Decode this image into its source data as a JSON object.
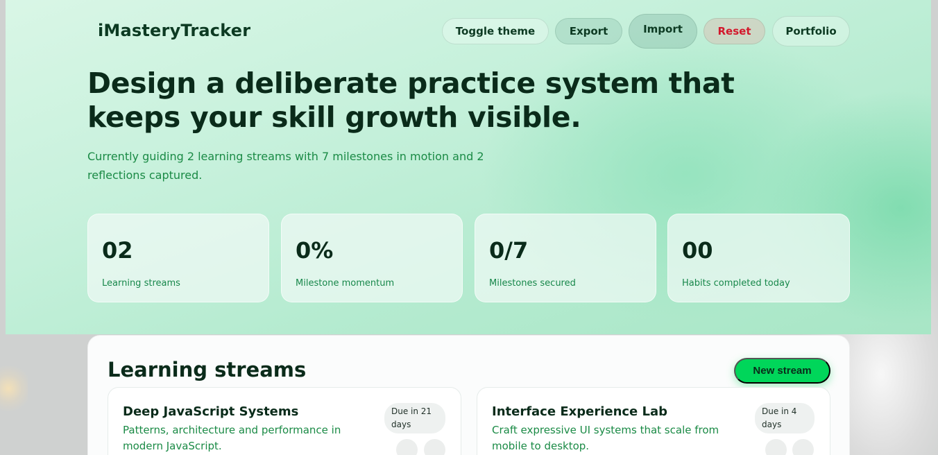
{
  "app": {
    "title": "iMasteryTracker"
  },
  "nav": {
    "toggle_theme": "Toggle theme",
    "export": "Export",
    "import": "Import",
    "reset": "Reset",
    "portfolio": "Portfolio"
  },
  "hero": {
    "headline": "Design a deliberate practice system that keeps your skill growth visible.",
    "subline": "Currently guiding 2 learning streams with 7 milestones in motion and 2 reflections captured."
  },
  "stats": [
    {
      "value": "02",
      "label": "Learning streams"
    },
    {
      "value": "0%",
      "label": "Milestone momentum"
    },
    {
      "value": "0/7",
      "label": "Milestones secured"
    },
    {
      "value": "00",
      "label": "Habits completed today"
    }
  ],
  "streams": {
    "title": "Learning streams",
    "new_button": "New stream",
    "items": [
      {
        "title": "Deep JavaScript Systems",
        "description": "Patterns, architecture and performance in modern JavaScript.",
        "due": "Due in 21 days"
      },
      {
        "title": "Interface Experience Lab",
        "description": "Craft expressive UI systems that scale from mobile to desktop.",
        "due": "Due in 4 days"
      }
    ]
  },
  "colors": {
    "accent": "#00d65a",
    "text_dark": "#0a2b1a",
    "text_green": "#1a8a45",
    "danger": "#d3182c"
  }
}
